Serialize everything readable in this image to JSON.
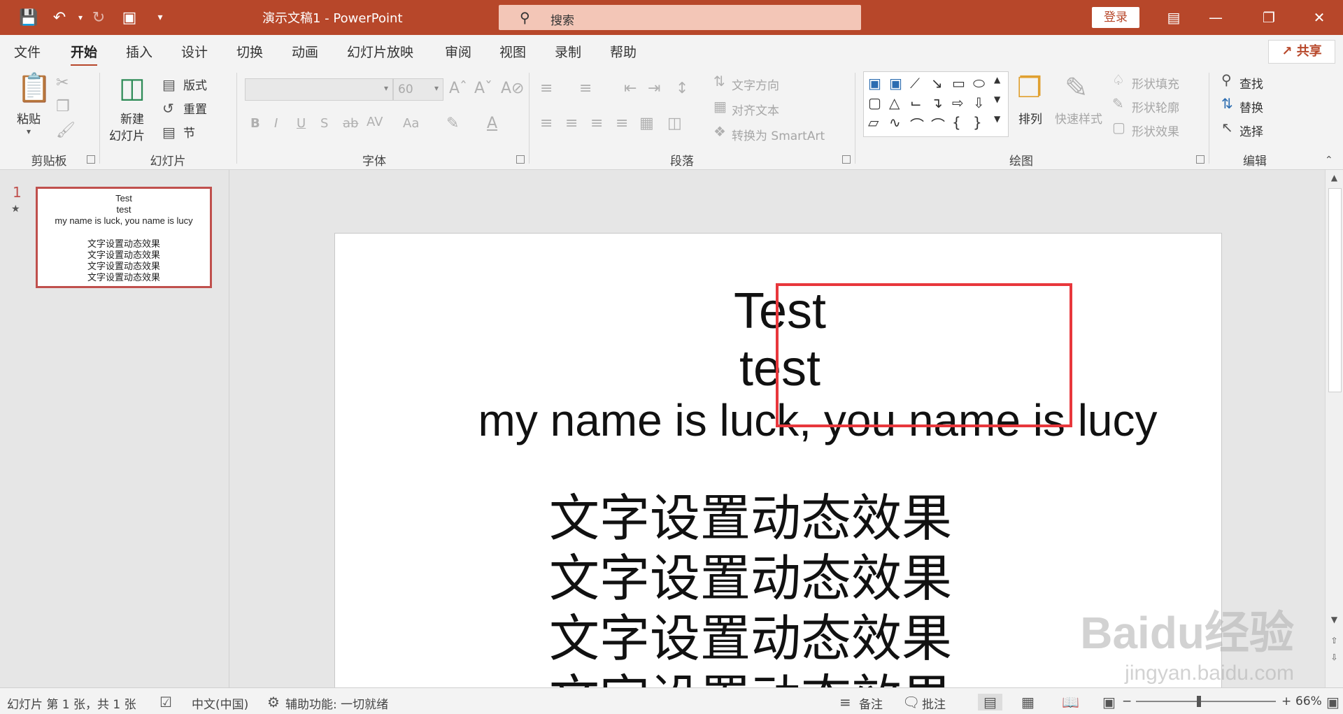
{
  "window": {
    "doc_title": "演示文稿1  -  PowerPoint",
    "search_placeholder": "搜索",
    "login_label": "登录"
  },
  "tabs": [
    {
      "label": "文件"
    },
    {
      "label": "开始",
      "active": true
    },
    {
      "label": "插入"
    },
    {
      "label": "设计"
    },
    {
      "label": "切换"
    },
    {
      "label": "动画"
    },
    {
      "label": "幻灯片放映"
    },
    {
      "label": "审阅"
    },
    {
      "label": "视图"
    },
    {
      "label": "录制"
    },
    {
      "label": "帮助"
    }
  ],
  "share_label": "共享",
  "ribbon": {
    "clipboard": {
      "paste": "粘贴",
      "group": "剪贴板"
    },
    "slides": {
      "new_slide_1": "新建",
      "new_slide_2": "幻灯片",
      "layout": "版式",
      "reset": "重置",
      "section": "节",
      "group": "幻灯片"
    },
    "font": {
      "size_value": "60",
      "group": "字体"
    },
    "paragraph": {
      "text_direction": "文字方向",
      "align_text": "对齐文本",
      "convert_smartart": "转换为 SmartArt",
      "group": "段落"
    },
    "drawing": {
      "arrange": "排列",
      "quick_styles": "快速样式",
      "shape_fill": "形状填充",
      "shape_outline": "形状轮廓",
      "shape_effects": "形状效果",
      "group": "绘图"
    },
    "editing": {
      "find": "查找",
      "replace": "替换",
      "select": "选择",
      "group": "编辑"
    }
  },
  "thumbnail": {
    "number": "1",
    "lines": [
      "Test",
      "test",
      "my name is luck, you name is lucy",
      "文字设置动态效果",
      "文字设置动态效果",
      "文字设置动态效果",
      "文字设置动态效果"
    ]
  },
  "slide": {
    "title_line1": "Test",
    "title_line2": "test",
    "subtitle": "my name is luck, you name is lucy",
    "body_lines": [
      "文字设置动态效果",
      "文字设置动态效果",
      "文字设置动态效果",
      "文字设置动态效果"
    ]
  },
  "status": {
    "slide_info": "幻灯片 第 1 张，共 1 张",
    "language": "中文(中国)",
    "accessibility": "辅助功能: 一切就绪",
    "notes": "备注",
    "comments": "批注",
    "zoom": "66%",
    "zoom_fraction": 0.45
  },
  "watermark": {
    "brand": "Baidu经验",
    "url": "jingyan.baidu.com"
  },
  "colors": {
    "accent": "#b7472a",
    "highlight_box": "#e8373c"
  }
}
